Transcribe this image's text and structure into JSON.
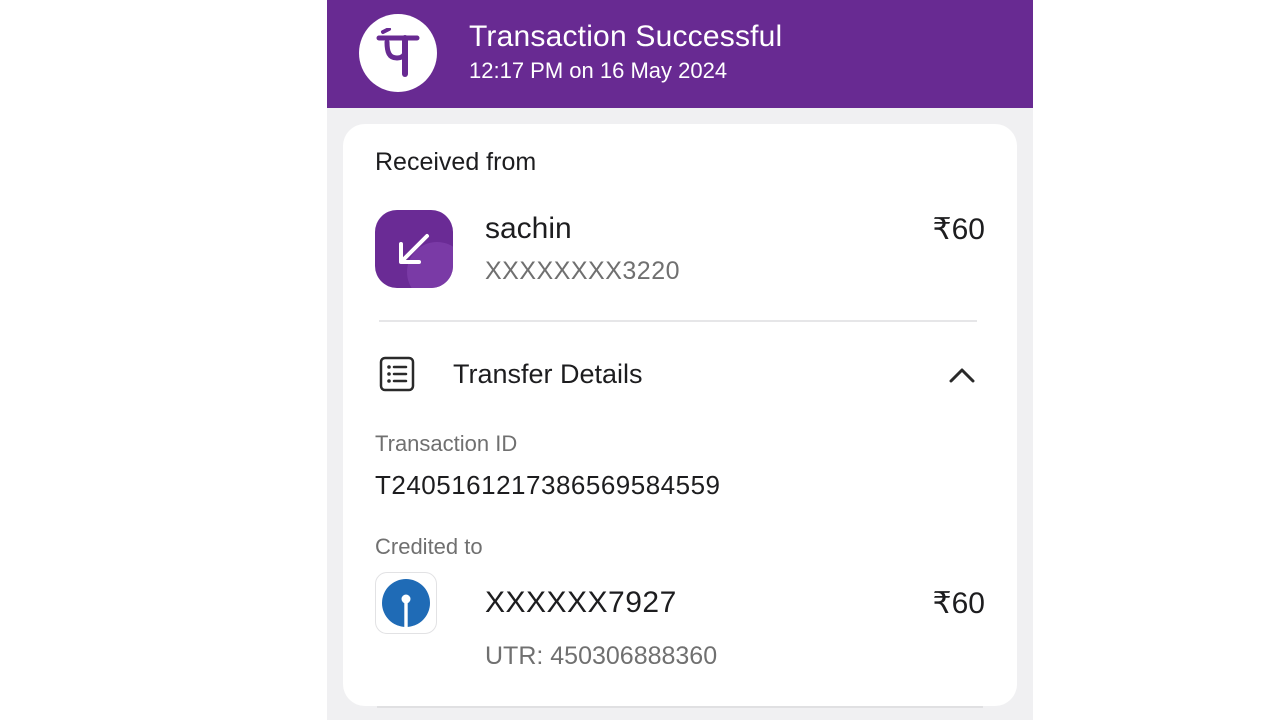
{
  "header": {
    "title": "Transaction Successful",
    "timestamp": "12:17 PM on 16 May 2024",
    "brand_color": "#682a92",
    "logo_glyph": "पे"
  },
  "received": {
    "section_label": "Received from",
    "sender_name": "sachin",
    "sender_account": "XXXXXXXX3220",
    "amount": "₹60",
    "icon": "incoming-arrow-icon"
  },
  "transfer_details": {
    "title": "Transfer Details",
    "icon": "receipt-list-icon",
    "toggle_icon": "chevron-up-icon",
    "transaction_id_label": "Transaction ID",
    "transaction_id": "T2405161217386569584559",
    "credited_to_label": "Credited to",
    "credited_account": "XXXXXX7927",
    "credited_amount": "₹60",
    "utr": "UTR: 450306888360",
    "bank_icon": "bank-logo-icon"
  }
}
